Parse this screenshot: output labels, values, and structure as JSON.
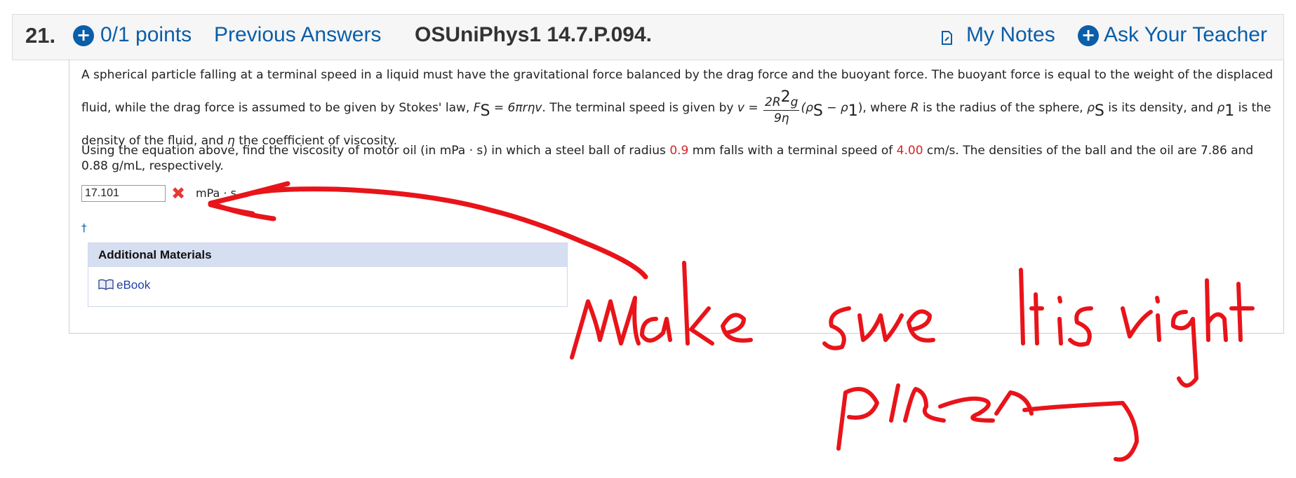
{
  "header": {
    "question_number": "21.",
    "points": "0/1 points",
    "previous_answers": "Previous Answers",
    "assignment_code": "OSUniPhys1 14.7.P.094.",
    "my_notes": "My Notes",
    "ask_teacher": "Ask Your Teacher"
  },
  "problem": {
    "p1_a": "A spherical particle falling at a terminal speed in a liquid must have the gravitational force balanced by the drag force and the buoyant force. The buoyant force is equal to the weight of the displaced fluid, while the drag force is assumed to be given by Stokes' law, ",
    "fs_label": "F",
    "fs_sub": "S",
    "stokes_rhs": " = 6πrηv",
    "p1_b": ". The terminal speed is given by ",
    "v_eq": "v = ",
    "frac_num": "2R",
    "frac_num_sup": "2",
    "frac_num_g": "g",
    "frac_den": "9η",
    "paren_open": "(ρ",
    "rho_s_sub": "S",
    "minus_rho": " − ρ",
    "rho_1_sub": "1",
    "paren_close": ")",
    "p1_c": ", where ",
    "r_var": "R",
    "p1_d": " is the radius of the sphere, ",
    "rho_s": "ρ",
    "rho_s2_sub": "S",
    "p1_e": " is its density, and ",
    "rho_1": "ρ",
    "rho_12_sub": "1",
    "p1_f": " is the density of the fluid, and ",
    "eta": "η",
    "p1_g": " the coefficient of viscosity.",
    "p2_a": "Using the equation above, find the viscosity of motor oil (in mPa · s) in which a steel ball of radius ",
    "radius_value": "0.9",
    "p2_b": " mm falls with a terminal speed of ",
    "speed_value": "4.00",
    "p2_c": " cm/s. The densities of the ball and the oil are 7.86 and 0.88 g/mL, respectively."
  },
  "answer": {
    "value": "17.101",
    "status": "incorrect",
    "unit": "mPa · s"
  },
  "dagger": "†",
  "additional_materials": {
    "title": "Additional Materials",
    "ebook": "eBook"
  },
  "handwriting": {
    "line1": "make sure it is right",
    "line2": "please"
  },
  "colors": {
    "link_blue": "#0b5ea8",
    "annotation_red": "#e8141a",
    "error_red": "#e53935"
  }
}
